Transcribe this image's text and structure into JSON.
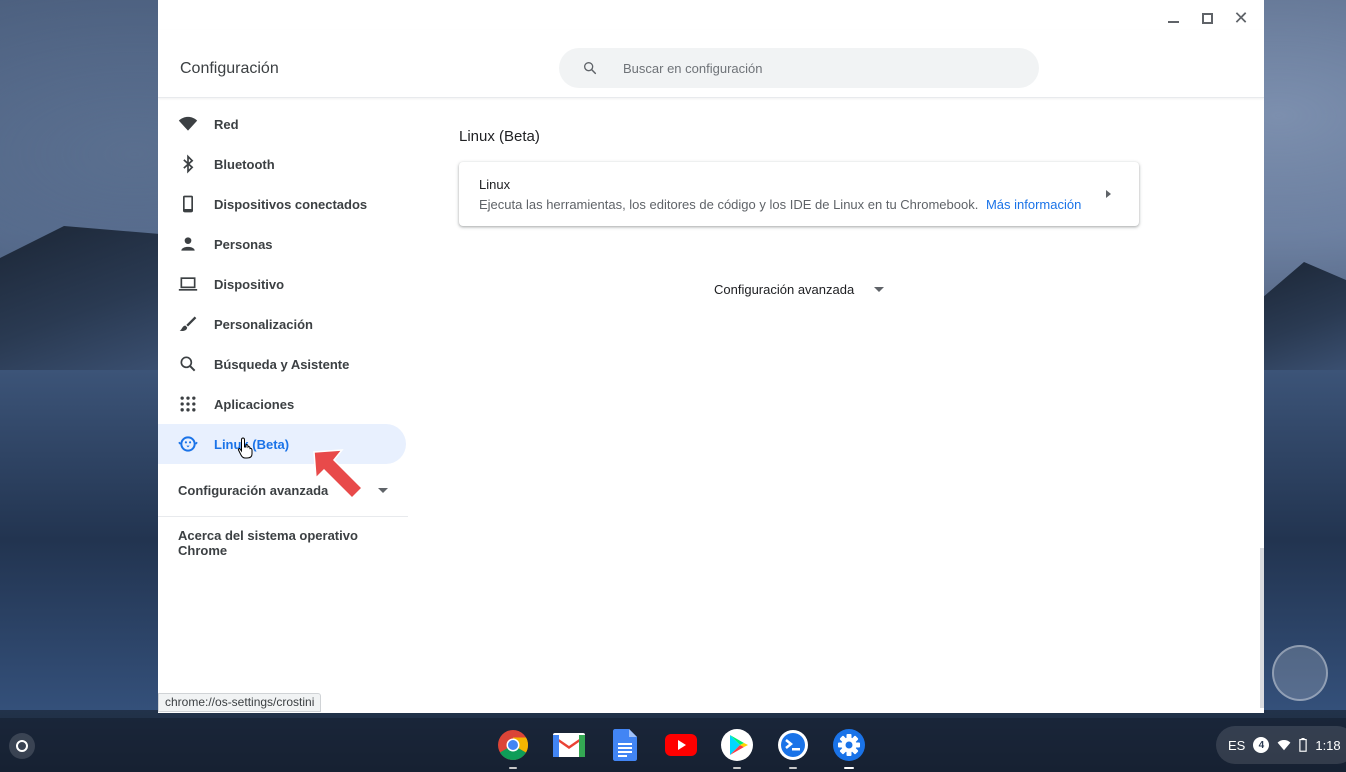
{
  "window": {
    "title": "Configuración",
    "search_placeholder": "Buscar en configuración"
  },
  "sidebar": {
    "items": [
      {
        "label": "Red",
        "icon": "wifi-icon"
      },
      {
        "label": "Bluetooth",
        "icon": "bluetooth-icon"
      },
      {
        "label": "Dispositivos conectados",
        "icon": "phone-icon"
      },
      {
        "label": "Personas",
        "icon": "person-icon"
      },
      {
        "label": "Dispositivo",
        "icon": "laptop-icon"
      },
      {
        "label": "Personalización",
        "icon": "brush-icon"
      },
      {
        "label": "Búsqueda y Asistente",
        "icon": "search-icon"
      },
      {
        "label": "Aplicaciones",
        "icon": "apps-grid-icon"
      },
      {
        "label": "Linux (Beta)",
        "icon": "penguin-icon",
        "active": true
      }
    ],
    "advanced_label": "Configuración avanzada",
    "about_label": "Acerca del sistema operativo Chrome"
  },
  "main": {
    "section_title": "Linux (Beta)",
    "card": {
      "title": "Linux",
      "description": "Ejecuta las herramientas, los editores de código y los IDE de Linux en tu Chromebook.",
      "link": "Más información"
    },
    "advanced_label": "Configuración avanzada"
  },
  "status_url": "chrome://os-settings/crostini",
  "shelf": {
    "apps": [
      "chrome-icon",
      "gmail-icon",
      "docs-icon",
      "youtube-icon",
      "play-store-icon",
      "terminal-icon",
      "settings-icon"
    ],
    "tray": {
      "language": "ES",
      "notification_count": "4",
      "time": "1:18"
    }
  },
  "colors": {
    "accent": "#1a73e8",
    "active_bg": "#e8f0fe"
  }
}
